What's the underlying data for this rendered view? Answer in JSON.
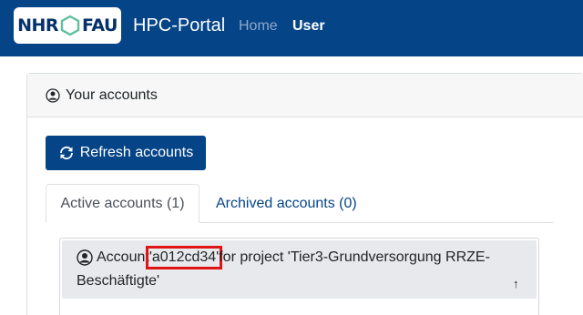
{
  "navbar": {
    "logo_left": "NHR",
    "logo_right": "FAU",
    "brand": "HPC-Portal",
    "links": [
      "Home",
      "User"
    ]
  },
  "card": {
    "header": "Your accounts",
    "refresh_label": "Refresh accounts",
    "tabs": [
      "Active accounts (1)",
      "Archived accounts (0)"
    ]
  },
  "account": {
    "prefix": "Account ",
    "id": "'a012cd34'",
    "suffix": " for project 'Tier3-Grundversorgung RRZE-",
    "line2": "Beschäftigte'",
    "sort_glyph": "↑"
  },
  "colors": {
    "navbar": "#054487",
    "link": "#054487",
    "highlight": "#e01515"
  }
}
